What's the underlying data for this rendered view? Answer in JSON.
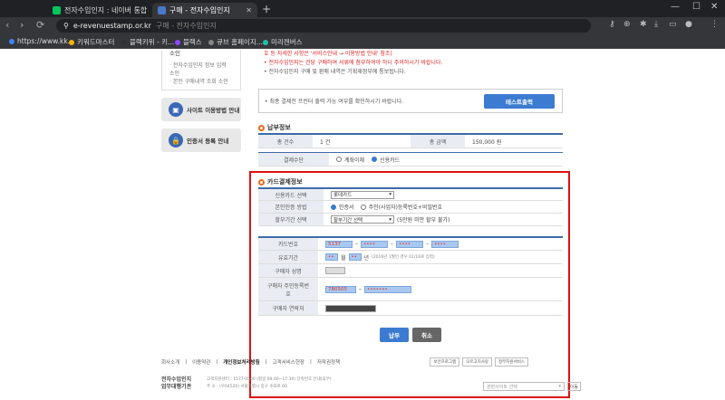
{
  "browser": {
    "tabs": [
      {
        "title": "전자수입인지 : 네이버 통합",
        "active": false
      },
      {
        "title": "구매 - 전자수입인지",
        "active": true
      }
    ],
    "url_host": "e-revenuestamp.or.kr",
    "url_title": "구매 - 전자수입인지",
    "bookmarks": [
      "https://www.kk...",
      "키워드마스터",
      "블랙키위 - 키...",
      "블랙스",
      "큐브 홈페이지...",
      "미리캔버스"
    ],
    "colors": {
      "tabbar": "#202124",
      "toolbar": "#35363a"
    }
  },
  "sidebar": {
    "box_head": "소인",
    "links": [
      "· 전자수입인지 정보 입력 소인",
      "· 본인 구매내역 조회 소인"
    ],
    "buttons": [
      {
        "label": "사이트 이용방법 안내",
        "icon": "monitor-icon"
      },
      {
        "label": "인증서 등록 안내",
        "icon": "lock-icon"
      }
    ]
  },
  "notice": {
    "lines": [
      {
        "text": "호 등 자세한 사항은 '서비스안내 → 이용방법 안내' 참조)",
        "style": "red"
      },
      {
        "text": "• 전자수입인지는 건당 구매하여 서류에 첨부하여야 하니 주의하시기 바랍니다.",
        "style": "red"
      },
      {
        "text": "• 전자수입인지 구매 및 환매 내역은 기획재정부에 통보됩니다.",
        "style": "gray"
      }
    ]
  },
  "print": {
    "text": "• 최종 결제전 프린터 출력 가능 여부를 확인하시기 바랍니다.",
    "button": "테스트출력"
  },
  "payment_info": {
    "title": "납부정보",
    "total_count_label": "총 건수",
    "total_count": "1 건",
    "total_amount_label": "총 금액",
    "total_amount": "150,000 원",
    "method_label": "결제수단",
    "method_options": [
      "계좌이체",
      "신용카드"
    ],
    "method_selected": "신용카드"
  },
  "card_info": {
    "title": "카드결제정보",
    "card_label": "신용카드 선택",
    "card_value": "롯데카드",
    "auth_label": "본인인증 방법",
    "auth_options": [
      "인증서",
      "주민(사업자)등록번호+비밀번호"
    ],
    "auth_selected": "인증서",
    "installment_label": "할부기간 선택",
    "installment_value": "할부기간 선택",
    "installment_note": "(5만원 미만 할부 불가)",
    "card_number_label": "카드번호",
    "card_number": [
      "5137",
      "••••",
      "••••",
      "••••"
    ],
    "expiry_label": "유효기간",
    "expiry_month": "••",
    "expiry_month_unit": "월",
    "expiry_year": "••",
    "expiry_year_unit": "년",
    "expiry_note": "(2016년 1월인 경우 01/16로 입력)",
    "name_label": "구매자 성명",
    "rrn_label": "구매자 주민등록번호",
    "rrn_front": "780505",
    "rrn_back": "•••••••",
    "phone_label": "구매자 연락처"
  },
  "actions": {
    "pay": "납부",
    "cancel": "취소",
    "pay_color": "#3b7bd1",
    "cancel_color": "#666666"
  },
  "footer": {
    "links": [
      "회사소개",
      "이용약관",
      "개인정보처리방침",
      "고객서비스헌장",
      "저작권정책"
    ],
    "badges": [
      "보안프로그램",
      "모르고치사랑",
      "정부지원서비스"
    ],
    "org": "전자수입인지 업무대행기관",
    "addr1": "고객지원센터 : 1577-0500 (평일 09:00~17:30) 단축번호 안내(휴무)",
    "addr2": "주    소 : (우04520) 서울특별시 중구 수표로 60",
    "related_sites": "관련사이트 선택",
    "go": "이동"
  }
}
